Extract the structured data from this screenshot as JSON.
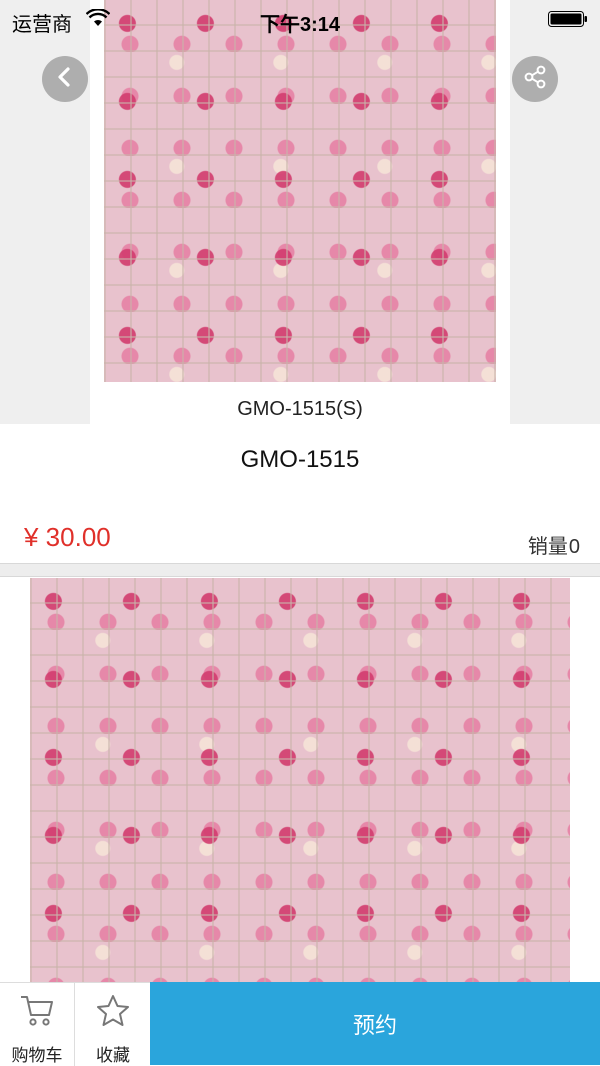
{
  "status_bar": {
    "carrier": "运营商",
    "time": "下午3:14"
  },
  "hero": {
    "caption": "GMO-1515(S)"
  },
  "product": {
    "name": "GMO-1515",
    "price": "¥ 30.00",
    "sales_label": "销量",
    "sales_count": "0"
  },
  "bottom_bar": {
    "cart_label": "购物车",
    "favorite_label": "收藏",
    "reserve_label": "预约"
  },
  "colors": {
    "price": "#e0302a",
    "reserve_button": "#2aa5dc",
    "tile_pink": "#e8c2cd"
  },
  "icons": {
    "back": "chevron-left-icon",
    "share": "share-icon",
    "cart": "cart-icon",
    "favorite": "star-icon",
    "wifi": "wifi-icon",
    "battery": "battery-icon"
  }
}
